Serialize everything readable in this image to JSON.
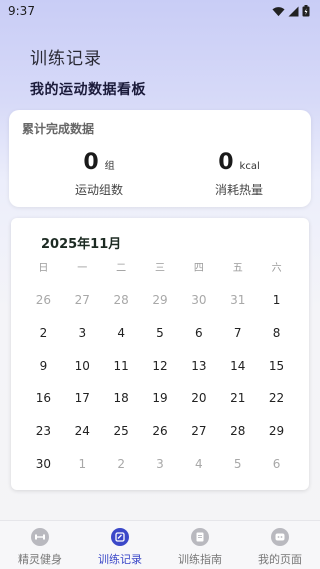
{
  "status_bar": {
    "time": "9:37"
  },
  "header": {
    "title": "训练记录",
    "subtitle": "我的运动数据看板"
  },
  "summary": {
    "title": "累计完成数据",
    "left": {
      "value": "0",
      "unit": "组",
      "label": "运动组数"
    },
    "right": {
      "value": "0",
      "unit": "kcal",
      "label": "消耗热量"
    }
  },
  "calendar": {
    "month_label": "2025年11月",
    "weekdays": [
      "日",
      "一",
      "二",
      "三",
      "四",
      "五",
      "六"
    ],
    "days": [
      {
        "d": "26",
        "cur": false
      },
      {
        "d": "27",
        "cur": false
      },
      {
        "d": "28",
        "cur": false
      },
      {
        "d": "29",
        "cur": false
      },
      {
        "d": "30",
        "cur": false
      },
      {
        "d": "31",
        "cur": false
      },
      {
        "d": "1",
        "cur": true
      },
      {
        "d": "2",
        "cur": true
      },
      {
        "d": "3",
        "cur": true
      },
      {
        "d": "4",
        "cur": true
      },
      {
        "d": "5",
        "cur": true
      },
      {
        "d": "6",
        "cur": true
      },
      {
        "d": "7",
        "cur": true
      },
      {
        "d": "8",
        "cur": true
      },
      {
        "d": "9",
        "cur": true
      },
      {
        "d": "10",
        "cur": true
      },
      {
        "d": "11",
        "cur": true
      },
      {
        "d": "12",
        "cur": true
      },
      {
        "d": "13",
        "cur": true
      },
      {
        "d": "14",
        "cur": true
      },
      {
        "d": "15",
        "cur": true
      },
      {
        "d": "16",
        "cur": true
      },
      {
        "d": "17",
        "cur": true
      },
      {
        "d": "18",
        "cur": true
      },
      {
        "d": "19",
        "cur": true
      },
      {
        "d": "20",
        "cur": true
      },
      {
        "d": "21",
        "cur": true
      },
      {
        "d": "22",
        "cur": true
      },
      {
        "d": "23",
        "cur": true
      },
      {
        "d": "24",
        "cur": true
      },
      {
        "d": "25",
        "cur": true
      },
      {
        "d": "26",
        "cur": true
      },
      {
        "d": "27",
        "cur": true
      },
      {
        "d": "28",
        "cur": true
      },
      {
        "d": "29",
        "cur": true
      },
      {
        "d": "30",
        "cur": true
      },
      {
        "d": "1",
        "cur": false
      },
      {
        "d": "2",
        "cur": false
      },
      {
        "d": "3",
        "cur": false
      },
      {
        "d": "4",
        "cur": false
      },
      {
        "d": "5",
        "cur": false
      },
      {
        "d": "6",
        "cur": false
      }
    ]
  },
  "tabs": [
    {
      "label": "精灵健身",
      "icon": "dumbbell-icon",
      "active": false
    },
    {
      "label": "训练记录",
      "icon": "record-icon",
      "active": true
    },
    {
      "label": "训练指南",
      "icon": "guide-icon",
      "active": false
    },
    {
      "label": "我的页面",
      "icon": "profile-icon",
      "active": false
    }
  ],
  "colors": {
    "accent": "#3b48c8",
    "inactive_tab": "#b9b9bf"
  }
}
